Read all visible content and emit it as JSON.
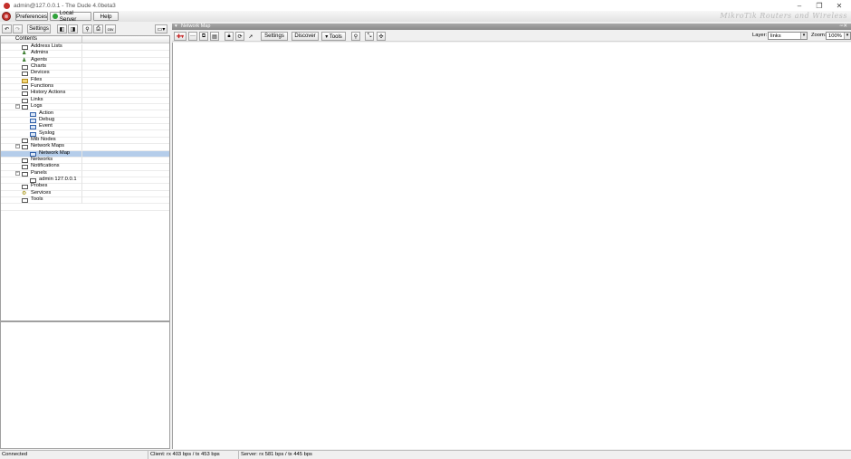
{
  "window": {
    "title": "admin@127.0.0.1 - The Dude 4.0beta3",
    "minimize": "–",
    "restore": "❐",
    "close": "✕"
  },
  "menubar": {
    "preferences": "Preferences",
    "local_server": "Local Server",
    "help": "Help",
    "brand": "MikroTik Routers and Wireless"
  },
  "left_toolbar": {
    "settings": "Settings"
  },
  "tree": {
    "header": "Contents",
    "items": [
      {
        "label": "Address Lists",
        "level": 1,
        "icon": "list-icon"
      },
      {
        "label": "Admins",
        "level": 1,
        "icon": "admin-icon"
      },
      {
        "label": "Agents",
        "level": 1,
        "icon": "agent-icon"
      },
      {
        "label": "Charts",
        "level": 1,
        "icon": "list-icon"
      },
      {
        "label": "Devices",
        "level": 1,
        "icon": "list-icon"
      },
      {
        "label": "Files",
        "level": 1,
        "icon": "folder-icon"
      },
      {
        "label": "Functions",
        "level": 1,
        "icon": "list-icon"
      },
      {
        "label": "History Actions",
        "level": 1,
        "icon": "list-icon"
      },
      {
        "label": "Links",
        "level": 1,
        "icon": "list-icon"
      },
      {
        "label": "Logs",
        "level": 1,
        "icon": "list-icon",
        "expander": "−"
      },
      {
        "label": "Action",
        "level": 2,
        "icon": "log-icon"
      },
      {
        "label": "Debug",
        "level": 2,
        "icon": "log-icon"
      },
      {
        "label": "Event",
        "level": 2,
        "icon": "log-icon"
      },
      {
        "label": "Syslog",
        "level": 2,
        "icon": "log-icon"
      },
      {
        "label": "Mib Nodes",
        "level": 1,
        "icon": "list-icon"
      },
      {
        "label": "Network Maps",
        "level": 1,
        "icon": "list-icon",
        "expander": "−"
      },
      {
        "label": "Network Map",
        "level": 2,
        "icon": "map-icon",
        "selected": true
      },
      {
        "label": "Networks",
        "level": 1,
        "icon": "list-icon"
      },
      {
        "label": "Notifications",
        "level": 1,
        "icon": "list-icon"
      },
      {
        "label": "Panels",
        "level": 1,
        "icon": "list-icon",
        "expander": "−"
      },
      {
        "label": "admin 127.0.0.1",
        "level": 2,
        "icon": "list-icon"
      },
      {
        "label": "Probes",
        "level": 1,
        "icon": "list-icon"
      },
      {
        "label": "Services",
        "level": 1,
        "icon": "service-icon"
      },
      {
        "label": "Tools",
        "level": 1,
        "icon": "list-icon"
      }
    ]
  },
  "main": {
    "title": "Network Map",
    "toolbar": {
      "settings": "Settings",
      "discover": "Discover",
      "tools": "▾ Tools",
      "layer_label": "Layer:",
      "layer_value": "links",
      "zoom_label": "Zoom:",
      "zoom_value": "100%"
    }
  },
  "status": {
    "connection": "Connected",
    "client": "Client: rx 403 bps / tx 453 bps",
    "server": "Server: rx 581 bps / tx 445 bps"
  }
}
